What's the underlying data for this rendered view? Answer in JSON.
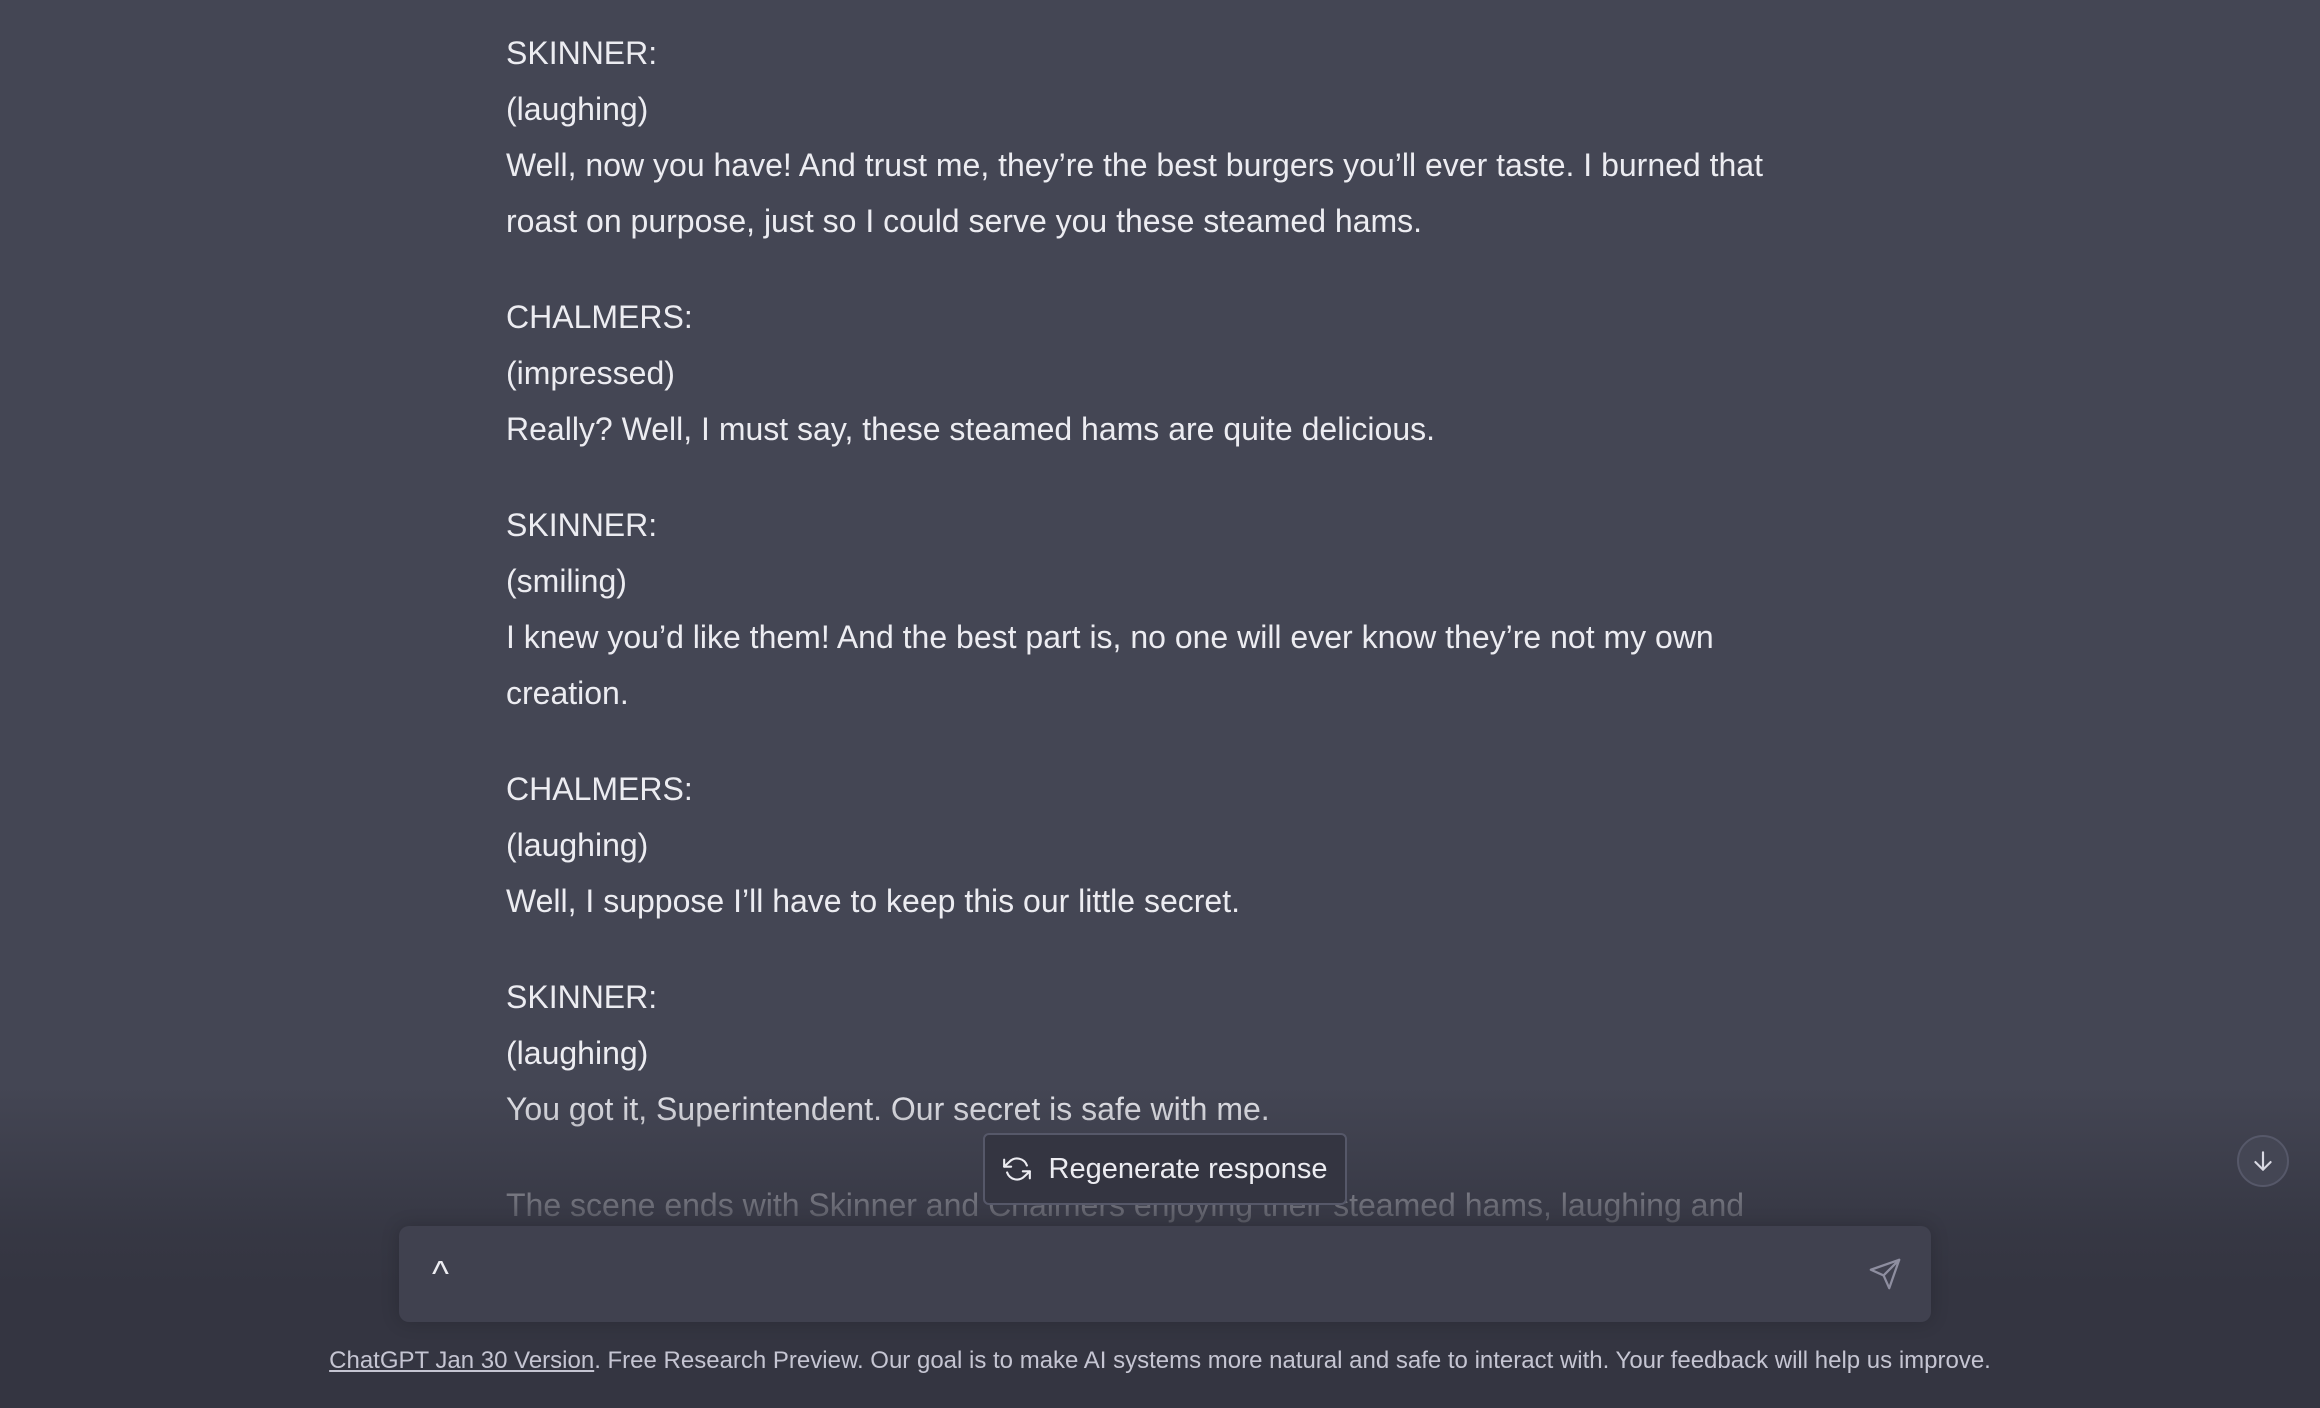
{
  "conversation": {
    "blocks": [
      {
        "speaker": "SKINNER:",
        "direction": "(laughing)",
        "lines": [
          "Well, now you have! And trust me, they’re the best burgers you’ll ever taste. I burned that",
          "roast on purpose, just so I could serve you these steamed hams."
        ]
      },
      {
        "speaker": "CHALMERS:",
        "direction": "(impressed)",
        "lines": [
          "Really? Well, I must say, these steamed hams are quite delicious."
        ]
      },
      {
        "speaker": "SKINNER:",
        "direction": "(smiling)",
        "lines": [
          "I knew you’d like them! And the best part is, no one will ever know they’re not my own",
          "creation."
        ]
      },
      {
        "speaker": "CHALMERS:",
        "direction": "(laughing)",
        "lines": [
          "Well, I suppose I’ll have to keep this our little secret."
        ]
      },
      {
        "speaker": "SKINNER:",
        "direction": "(laughing)",
        "lines": [
          "You got it, Superintendent. Our secret is safe with me."
        ]
      }
    ],
    "closing_line": "The scene ends with Skinner and Chalmers enjoying their steamed hams, laughing and"
  },
  "regenerate": {
    "label": "Regenerate response",
    "icon": "refresh-icon"
  },
  "scroll_down": {
    "icon": "arrow-down-icon"
  },
  "composer": {
    "value": "^",
    "send_icon": "paper-plane-icon"
  },
  "footer": {
    "link_text": "ChatGPT Jan 30 Version",
    "text": ". Free Research Preview. Our goal is to make AI systems more natural and safe to interact with. Your feedback will help us improve."
  },
  "colors": {
    "background": "#444654",
    "composer_background": "#40414f",
    "bottom_area": "#343541",
    "text": "#ececf1",
    "muted_text": "#c5c5d2"
  }
}
